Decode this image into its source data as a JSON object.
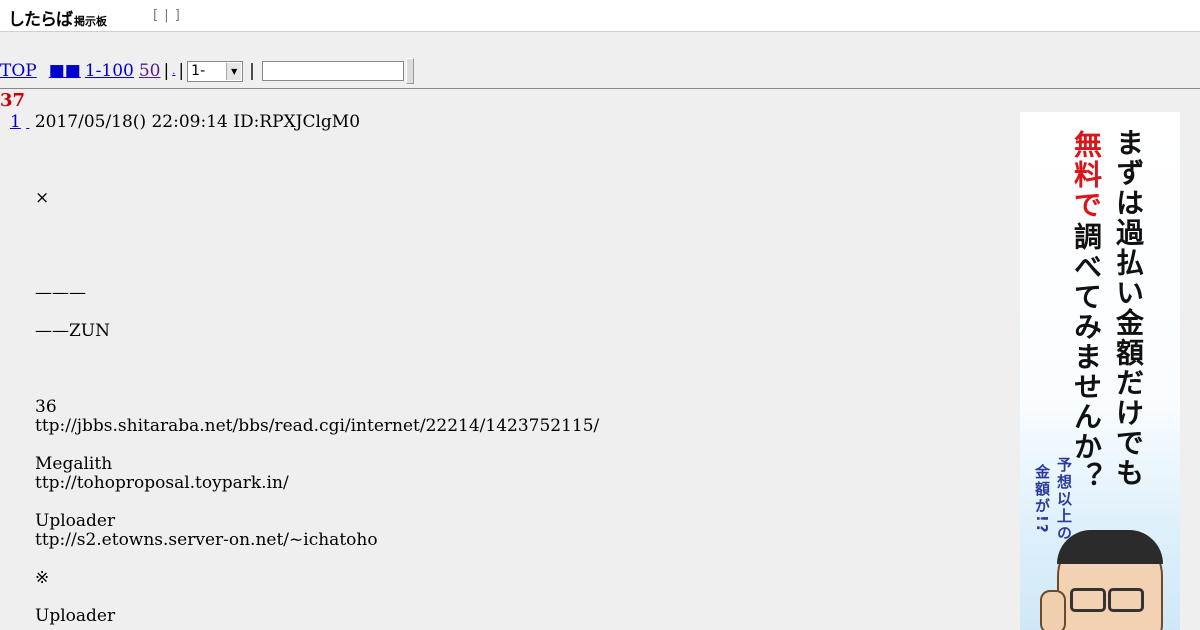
{
  "header": {
    "logo_main": "したらば",
    "logo_sub": "掲示板",
    "nav": "[ | ]"
  },
  "toolbar": {
    "top": "TOP",
    "squares": "■■",
    "range": "1-100",
    "latest": "50",
    "pipe": "|",
    "dot": ".",
    "select_value": "1-"
  },
  "thread": {
    "title": "37"
  },
  "post": {
    "number": "1",
    "datetime": "2017/05/18() 22:09:14 ID:RPXJClgM0",
    "lines": [
      "×",
      "———",
      "——ZUN",
      "36",
      "ttp://jbbs.shitaraba.net/bbs/read.cgi/internet/22214/1423752115/",
      "Megalith",
      "ttp://tohoproposal.toypark.in/",
      "Uploader",
      "ttp://s2.etowns.server-on.net/~ichatoho",
      "※",
      "Uploader"
    ]
  },
  "ad": {
    "line1": "まずは過払い金額だけでも",
    "line2_red": "無料で",
    "line2": "調べてみませんか？",
    "line3": "予想以上の",
    "line4": "金額が!?",
    "accent_red": "#d9161c",
    "accent_blue": "#2a3b9c"
  }
}
